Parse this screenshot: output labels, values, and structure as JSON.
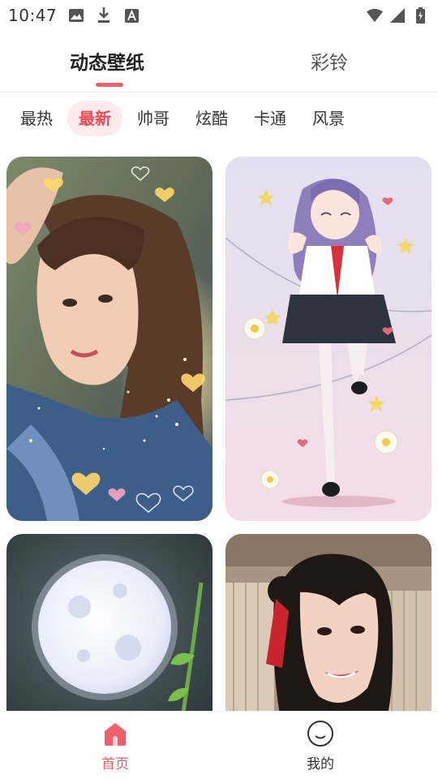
{
  "status_bar": {
    "time": "10:47",
    "left_icons": [
      "image-icon",
      "download-icon",
      "font-icon"
    ],
    "right_icons": [
      "wifi-icon",
      "signal-icon",
      "battery-icon"
    ]
  },
  "top_tabs": [
    {
      "label": "动态壁纸",
      "active": true
    },
    {
      "label": "彩铃",
      "active": false
    }
  ],
  "categories": [
    {
      "label": "最热",
      "active": false
    },
    {
      "label": "最新",
      "active": true
    },
    {
      "label": "帅哥",
      "active": false
    },
    {
      "label": "炫酷",
      "active": false
    },
    {
      "label": "卡通",
      "active": false
    },
    {
      "label": "风景",
      "active": false
    }
  ],
  "wallpapers": [
    {
      "subject": "girl-with-hearts-bokeh"
    },
    {
      "subject": "anime-schoolgirl-flowers"
    },
    {
      "subject": "full-moon-night"
    },
    {
      "subject": "smiling-girl-red-ribbon"
    }
  ],
  "bottom_nav": [
    {
      "label": "首页",
      "active": true,
      "icon": "home-icon"
    },
    {
      "label": "我的",
      "active": false,
      "icon": "smile-face-icon"
    }
  ],
  "colors": {
    "accent": "#f0606b",
    "chip_active_bg": "#fdeaec",
    "chip_active_text": "#ef4a57"
  }
}
